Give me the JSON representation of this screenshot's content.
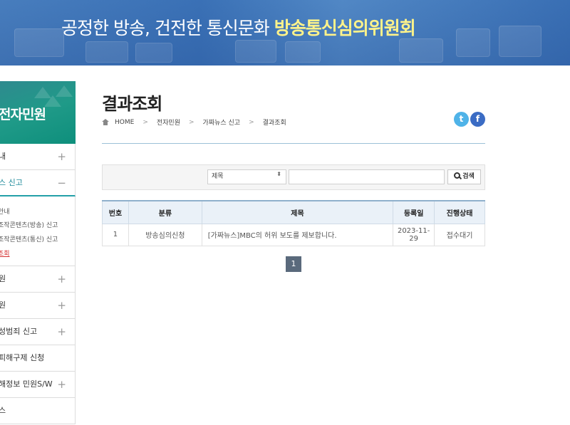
{
  "banner": {
    "slogan_normal": "공정한 방송, 건전한 통신문화 ",
    "slogan_bold": "방송통신심의위원회"
  },
  "sidebar": {
    "title": "전자민원",
    "items": [
      {
        "label": "내",
        "sign": "+"
      },
      {
        "label": "스 신고",
        "sign": "−",
        "active": true
      },
      {
        "label": "원",
        "sign": "+"
      },
      {
        "label": "원",
        "sign": "+"
      },
      {
        "label": "성범죄 신고",
        "sign": "+"
      },
      {
        "label": "피해구제 신청",
        "sign": ""
      },
      {
        "label": "해정보 민원S/W",
        "sign": "+"
      },
      {
        "label": "스",
        "sign": ""
      }
    ],
    "subitems": [
      "안내",
      "조작콘텐츠(방송) 신고",
      "조작콘텐츠(통신) 신고",
      "조회"
    ]
  },
  "page": {
    "title": "결과조회",
    "breadcrumb": [
      "HOME",
      "전자민원",
      "가짜뉴스 신고",
      "결과조회"
    ],
    "sns": {
      "twitter": "t",
      "facebook": "f"
    }
  },
  "search": {
    "select_value": "제목",
    "select_arrow": "⬍",
    "input_value": "",
    "button_label": "검색"
  },
  "table": {
    "headers": [
      "번호",
      "분류",
      "제목",
      "등록일",
      "진행상태"
    ],
    "rows": [
      {
        "no": "1",
        "category": "방송심의신청",
        "title": "[가짜뉴스]MBC의 허위 보도를 제보합니다.",
        "date": "2023-11-29",
        "status": "접수대기"
      }
    ]
  },
  "pagination": {
    "current": "1"
  }
}
